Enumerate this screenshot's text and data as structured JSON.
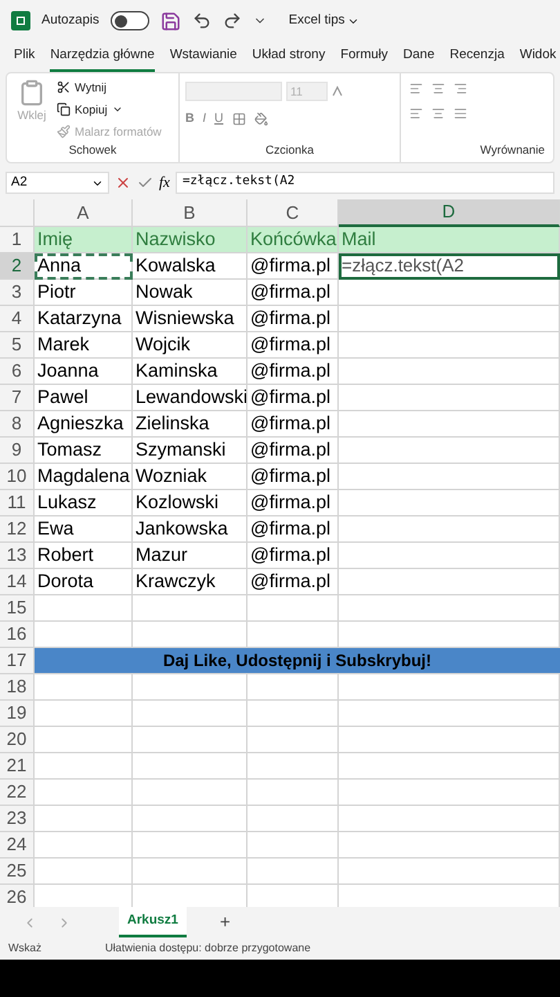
{
  "title_bar": {
    "autosave_label": "Autozapis",
    "autosave_on": false,
    "file_name": "Excel tips"
  },
  "ribbon_tabs": [
    {
      "label": "Plik",
      "selected": false
    },
    {
      "label": "Narzędzia główne",
      "selected": true
    },
    {
      "label": "Wstawianie",
      "selected": false
    },
    {
      "label": "Układ strony",
      "selected": false
    },
    {
      "label": "Formuły",
      "selected": false
    },
    {
      "label": "Dane",
      "selected": false
    },
    {
      "label": "Recenzja",
      "selected": false
    },
    {
      "label": "Widok",
      "selected": false
    }
  ],
  "clipboard_group": {
    "label": "Schowek",
    "paste": {
      "label": "Wklej",
      "disabled": true
    },
    "cut": {
      "label": "Wytnij",
      "disabled": false
    },
    "copy": {
      "label": "Kopiuj",
      "disabled": false
    },
    "format_painter": {
      "label": "Malarz formatów",
      "disabled": true
    }
  },
  "font_group": {
    "label": "Czcionka",
    "font_size": "11",
    "bold": "B",
    "italic": "I",
    "underline": "U"
  },
  "alignment_group": {
    "label": "Wyrównanie"
  },
  "formula_bar": {
    "name_box": "A2",
    "function_label": "fx",
    "formula": "=złącz.tekst(A2"
  },
  "columns": [
    "A",
    "B",
    "C",
    "D"
  ],
  "rows": [
    {
      "number": "1",
      "kind": "header",
      "cells": [
        "Imię",
        "Nazwisko",
        "Końcówka",
        "Mail"
      ]
    },
    {
      "number": "2",
      "kind": "data",
      "cells": [
        "Anna",
        "Kowalska",
        "@firma.pl",
        "=złącz.tekst(A2"
      ]
    },
    {
      "number": "3",
      "kind": "data",
      "cells": [
        "Piotr",
        "Nowak",
        "@firma.pl",
        ""
      ]
    },
    {
      "number": "4",
      "kind": "data",
      "cells": [
        "Katarzyna",
        "Wisniewska",
        "@firma.pl",
        ""
      ]
    },
    {
      "number": "5",
      "kind": "data",
      "cells": [
        "Marek",
        "Wojcik",
        "@firma.pl",
        ""
      ]
    },
    {
      "number": "6",
      "kind": "data",
      "cells": [
        "Joanna",
        "Kaminska",
        "@firma.pl",
        ""
      ]
    },
    {
      "number": "7",
      "kind": "data",
      "cells": [
        "Pawel",
        "Lewandowski",
        "@firma.pl",
        ""
      ]
    },
    {
      "number": "8",
      "kind": "data",
      "cells": [
        "Agnieszka",
        "Zielinska",
        "@firma.pl",
        ""
      ]
    },
    {
      "number": "9",
      "kind": "data",
      "cells": [
        "Tomasz",
        "Szymanski",
        "@firma.pl",
        ""
      ]
    },
    {
      "number": "10",
      "kind": "data",
      "cells": [
        "Magdalena",
        "Wozniak",
        "@firma.pl",
        ""
      ]
    },
    {
      "number": "11",
      "kind": "data",
      "cells": [
        "Lukasz",
        "Kozlowski",
        "@firma.pl",
        ""
      ]
    },
    {
      "number": "12",
      "kind": "data",
      "cells": [
        "Ewa",
        "Jankowska",
        "@firma.pl",
        ""
      ]
    },
    {
      "number": "13",
      "kind": "data",
      "cells": [
        "Robert",
        "Mazur",
        "@firma.pl",
        ""
      ]
    },
    {
      "number": "14",
      "kind": "data",
      "cells": [
        "Dorota",
        "Krawczyk",
        "@firma.pl",
        ""
      ]
    },
    {
      "number": "15",
      "kind": "empty"
    },
    {
      "number": "16",
      "kind": "empty"
    },
    {
      "number": "17",
      "kind": "banner",
      "text": "Daj Like, Udostępnij i Subskrybuj!"
    },
    {
      "number": "18",
      "kind": "empty"
    },
    {
      "number": "19",
      "kind": "empty"
    },
    {
      "number": "20",
      "kind": "empty"
    },
    {
      "number": "21",
      "kind": "empty"
    },
    {
      "number": "22",
      "kind": "empty"
    },
    {
      "number": "23",
      "kind": "empty"
    },
    {
      "number": "24",
      "kind": "empty"
    },
    {
      "number": "25",
      "kind": "empty"
    },
    {
      "number": "26",
      "kind": "empty"
    }
  ],
  "sheet_tabs": [
    {
      "label": "Arkusz1",
      "selected": true
    }
  ],
  "add_sheet": "+",
  "status_bar": {
    "mode": "Wskaż",
    "accessibility": "Ułatwienia dostępu: dobrze przygotowane"
  }
}
